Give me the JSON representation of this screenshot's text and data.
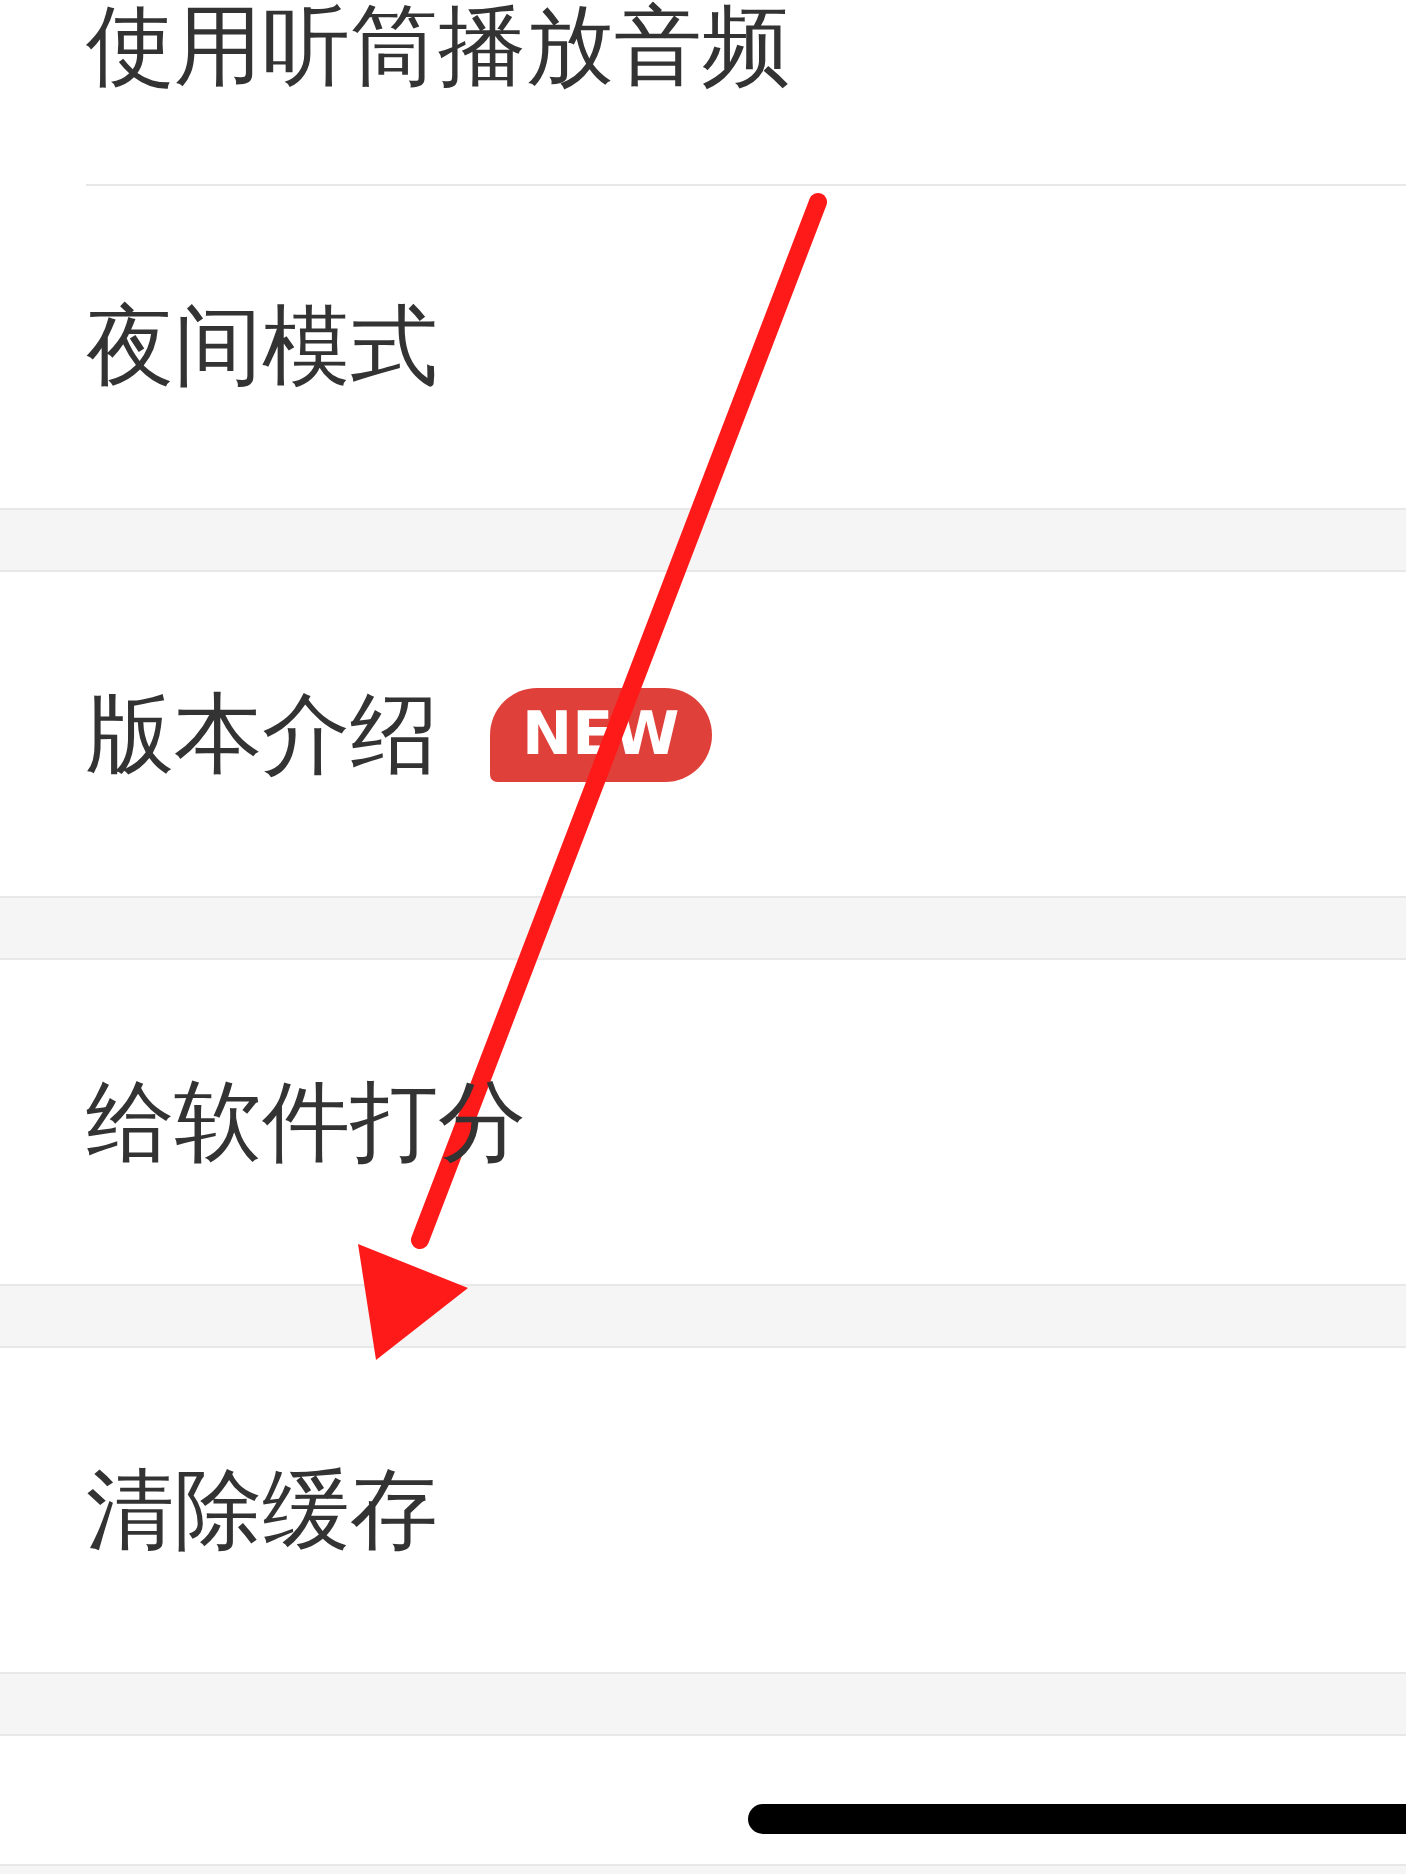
{
  "sections": [
    {
      "items": [
        {
          "label": "使用听筒播放音频"
        },
        {
          "label": "夜间模式"
        }
      ]
    },
    {
      "items": [
        {
          "label": "版本介绍",
          "badge": "NEW"
        }
      ]
    },
    {
      "items": [
        {
          "label": "给软件打分"
        }
      ]
    },
    {
      "items": [
        {
          "label": "清除缓存"
        }
      ]
    }
  ]
}
